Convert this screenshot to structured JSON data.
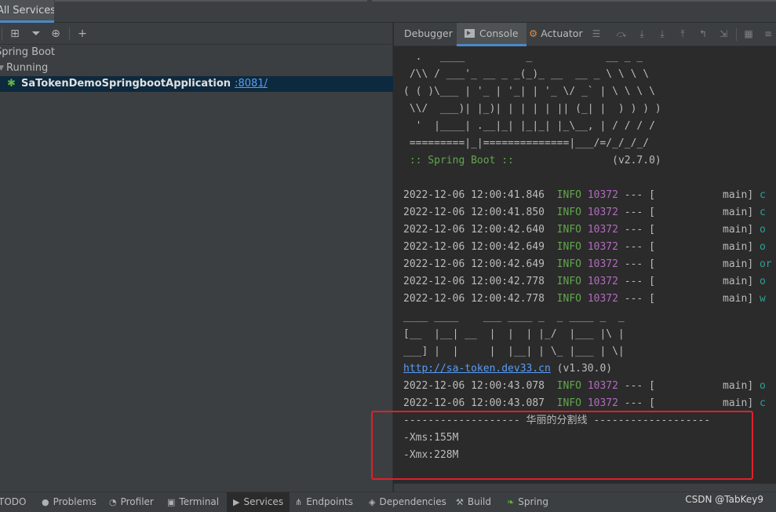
{
  "top_tab": "All Services",
  "tree": {
    "group": "Spring Boot",
    "status": "Running",
    "app_name": "SaTokenDemoSpringbootApplication",
    "app_port": ":8081/"
  },
  "right_tabs": {
    "debugger": "Debugger",
    "console": "Console",
    "actuator": "Actuator"
  },
  "console": {
    "banner": [
      "  .   ____          _            __ _ _",
      " /\\\\ / ___'_ __ _ _(_)_ __  __ _ \\ \\ \\ \\",
      "( ( )\\___ | '_ | '_| | '_ \\/ _` | \\ \\ \\ \\",
      " \\\\/  ___)| |_)| | | | | || (_| |  ) ) ) )",
      "  '  |____| .__|_| |_|_| |_\\__, | / / / /",
      " =========|_|==============|___/=/_/_/_/"
    ],
    "spring_boot_label": " :: Spring Boot :: ",
    "spring_boot_version": "               (v2.7.0)",
    "log_lines_1": [
      {
        "ts": "2022-12-06 12:00:41.846",
        "level": "INFO",
        "pid": "10372",
        "sep": " --- [           main]",
        "logger": " c"
      },
      {
        "ts": "2022-12-06 12:00:41.850",
        "level": "INFO",
        "pid": "10372",
        "sep": " --- [           main]",
        "logger": " c"
      },
      {
        "ts": "2022-12-06 12:00:42.640",
        "level": "INFO",
        "pid": "10372",
        "sep": " --- [           main]",
        "logger": " o"
      },
      {
        "ts": "2022-12-06 12:00:42.649",
        "level": "INFO",
        "pid": "10372",
        "sep": " --- [           main]",
        "logger": " o"
      },
      {
        "ts": "2022-12-06 12:00:42.649",
        "level": "INFO",
        "pid": "10372",
        "sep": " --- [           main]",
        "logger": " or"
      },
      {
        "ts": "2022-12-06 12:00:42.778",
        "level": "INFO",
        "pid": "10372",
        "sep": " --- [           main]",
        "logger": " o"
      },
      {
        "ts": "2022-12-06 12:00:42.778",
        "level": "INFO",
        "pid": "10372",
        "sep": " --- [           main]",
        "logger": " w"
      }
    ],
    "satoken_banner": [
      "____ ____    ___ ____ _  _ ____ _  _",
      "[__  |__| __  |  |  | |_/  |___ |\\ |",
      "___] |  |     |  |__| | \\_ |___ | \\|"
    ],
    "satoken_url": "http://sa-token.dev33.cn",
    "satoken_version": " (v1.30.0)",
    "log_lines_2": [
      {
        "ts": "2022-12-06 12:00:43.078",
        "level": "INFO",
        "pid": "10372",
        "sep": " --- [           main]",
        "logger": " o"
      },
      {
        "ts": "2022-12-06 12:00:43.087",
        "level": "INFO",
        "pid": "10372",
        "sep": " --- [           main]",
        "logger": " c"
      }
    ],
    "divider": "------------------- 华丽的分割线 -------------------",
    "xms": "-Xms:155M",
    "xmx": "-Xmx:228M"
  },
  "bottom_bar": {
    "todo": "TODO",
    "problems": "Problems",
    "profiler": "Profiler",
    "terminal": "Terminal",
    "services": "Services",
    "endpoints": "Endpoints",
    "dependencies": "Dependencies",
    "build": "Build",
    "spring": "Spring"
  },
  "watermark": "CSDN @TabKey9",
  "colors": {
    "accent": "#4a88c7",
    "highlight_box": "#e0202a",
    "info": "#62a54e",
    "pid": "#b26ac0"
  }
}
